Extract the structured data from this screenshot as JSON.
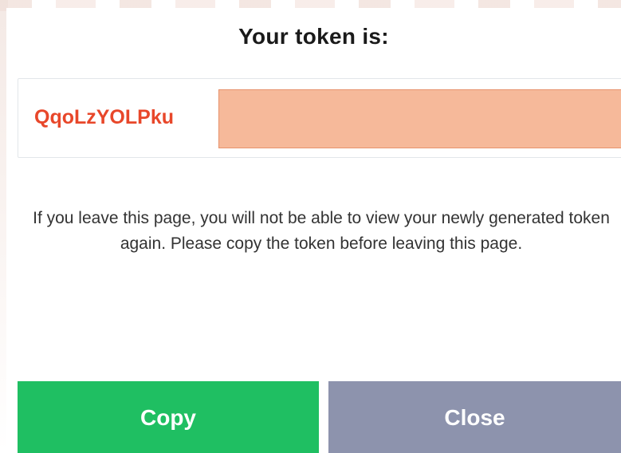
{
  "modal": {
    "title": "Your token is:",
    "token_visible": "QqoLzYOLPku",
    "warning": "If you leave this page, you will not be able to view your newly generated token again. Please copy the token before leaving this page.",
    "buttons": {
      "copy_label": "Copy",
      "close_label": "Close"
    }
  },
  "colors": {
    "token_text": "#e8472a",
    "redaction": "#f6b99a",
    "copy_button": "#1fbf62",
    "close_button": "#8d93ad"
  }
}
